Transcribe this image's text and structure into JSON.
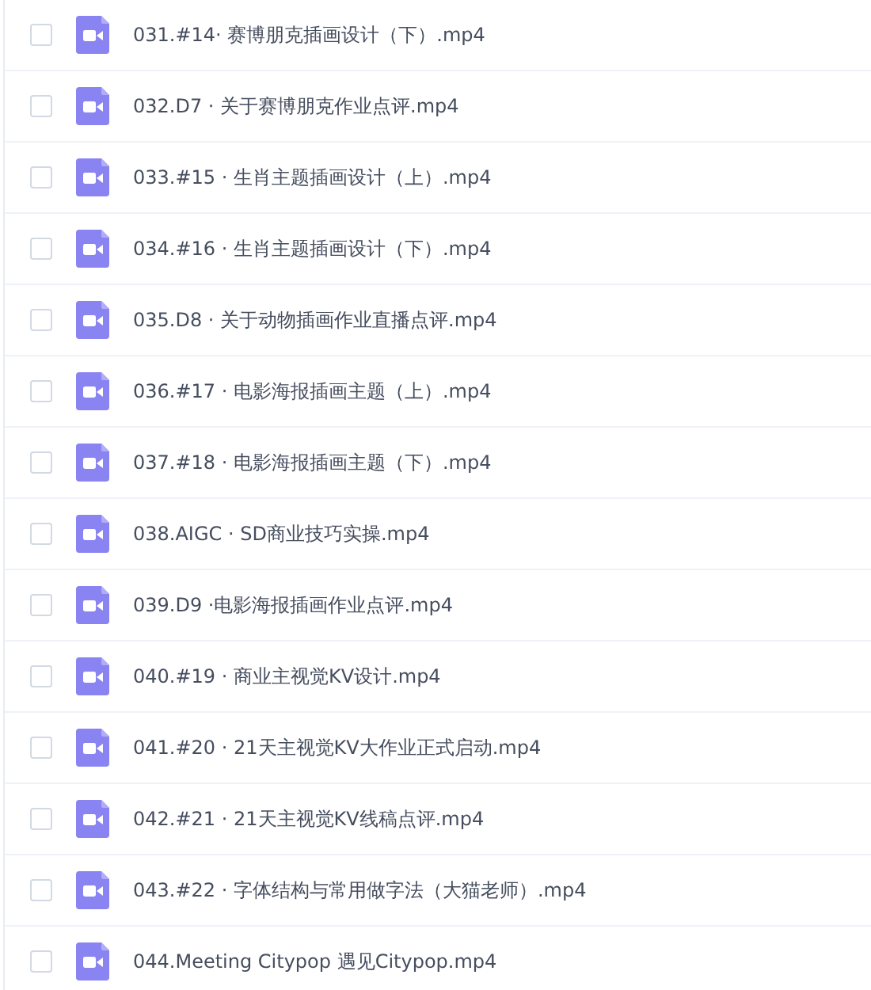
{
  "files": [
    {
      "name": "031.#14· 赛博朋克插画设计（下）.mp4",
      "checked": false
    },
    {
      "name": "032.D7 · 关于赛博朋克作业点评.mp4",
      "checked": false
    },
    {
      "name": "033.#15 · 生肖主题插画设计（上）.mp4",
      "checked": false
    },
    {
      "name": "034.#16 · 生肖主题插画设计（下）.mp4",
      "checked": false
    },
    {
      "name": "035.D8 · 关于动物插画作业直播点评.mp4",
      "checked": false
    },
    {
      "name": "036.#17 · 电影海报插画主题（上）.mp4",
      "checked": false
    },
    {
      "name": "037.#18 · 电影海报插画主题（下）.mp4",
      "checked": false
    },
    {
      "name": "038.AIGC · SD商业技巧实操.mp4",
      "checked": false
    },
    {
      "name": "039.D9 ·电影海报插画作业点评.mp4",
      "checked": false
    },
    {
      "name": "040.#19 · 商业主视觉KV设计.mp4",
      "checked": false
    },
    {
      "name": "041.#20 · 21天主视觉KV大作业正式启动.mp4",
      "checked": false
    },
    {
      "name": "042.#21 · 21天主视觉KV线稿点评.mp4",
      "checked": false
    },
    {
      "name": "043.#22 · 字体结构与常用做字法（大猫老师）.mp4",
      "checked": false
    },
    {
      "name": "044.Meeting Citypop 遇见Citypop.mp4",
      "checked": false
    }
  ]
}
